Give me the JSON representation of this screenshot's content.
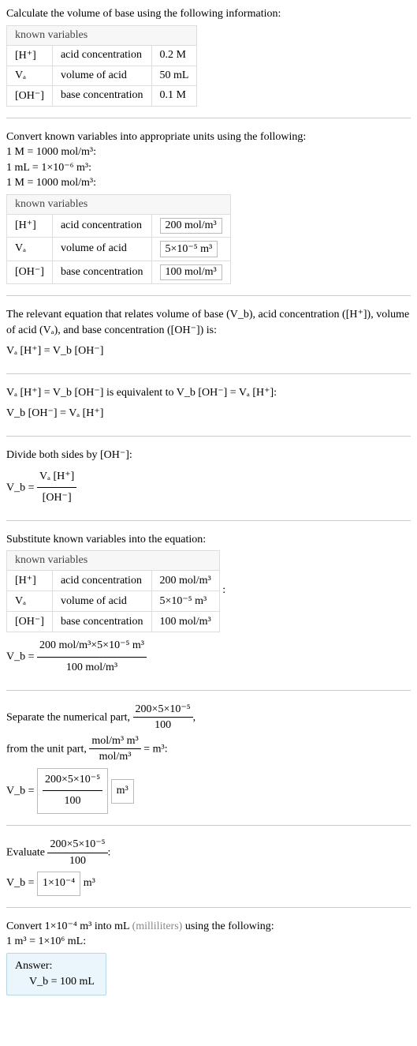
{
  "header1": "Calculate the volume of base using the following information:",
  "knownLabel": "known variables",
  "t1": {
    "r1": {
      "sym": "[H⁺]",
      "desc": "acid concentration",
      "val": "0.2 M"
    },
    "r2": {
      "sym": "Vₐ",
      "desc": "volume of acid",
      "val": "50 mL"
    },
    "r3": {
      "sym": "[OH⁻]",
      "desc": "base concentration",
      "val": "0.1 M"
    }
  },
  "convHeader": "Convert known variables into appropriate units using the following:",
  "conv1": "1 M = 1000 mol/m³:",
  "conv2": "1 mL = 1×10⁻⁶ m³:",
  "conv3": "1 M = 1000 mol/m³:",
  "t2": {
    "r1": {
      "sym": "[H⁺]",
      "desc": "acid concentration",
      "val": "200 mol/m³"
    },
    "r2": {
      "sym": "Vₐ",
      "desc": "volume of acid",
      "val": "5×10⁻⁵ m³"
    },
    "r3": {
      "sym": "[OH⁻]",
      "desc": "base concentration",
      "val": "100 mol/m³"
    }
  },
  "relText": "The relevant equation that relates volume of base (V_b), acid concentration ([H⁺]), volume of acid (Vₐ), and base concentration ([OH⁻]) is:",
  "relEq": "Vₐ [H⁺] = V_b [OH⁻]",
  "equivText": "Vₐ [H⁺] = V_b [OH⁻] is equivalent to V_b [OH⁻] = Vₐ [H⁺]:",
  "equivEq": "V_b [OH⁻] = Vₐ [H⁺]",
  "divText": "Divide both sides by [OH⁻]:",
  "divEq": {
    "lhs": "V_b = ",
    "num": "Vₐ [H⁺]",
    "den": "[OH⁻]"
  },
  "subHeader": "Substitute known variables into the equation:",
  "t3": {
    "r1": {
      "sym": "[H⁺]",
      "desc": "acid concentration",
      "val": "200 mol/m³"
    },
    "r2": {
      "sym": "Vₐ",
      "desc": "volume of acid",
      "val": "5×10⁻⁵ m³"
    },
    "r3": {
      "sym": "[OH⁻]",
      "desc": "base concentration",
      "val": "100 mol/m³"
    }
  },
  "subEq": {
    "lhs": "V_b = ",
    "num": "200 mol/m³×5×10⁻⁵ m³",
    "den": "100 mol/m³"
  },
  "sepText1": "Separate the numerical part, ",
  "sepFrac": {
    "num": "200×5×10⁻⁵",
    "den": "100"
  },
  "sepComma": ",",
  "sepText2": "from the unit part, ",
  "unitFrac": {
    "num": "mol/m³ m³",
    "den": "mol/m³"
  },
  "unitEq": " = m³:",
  "sepEq": {
    "lhs": "V_b = ",
    "num": "200×5×10⁻⁵",
    "den": "100",
    "unit": "m³"
  },
  "evalText": "Evaluate ",
  "evalFrac": {
    "num": "200×5×10⁻⁵",
    "den": "100"
  },
  "evalColon": ":",
  "evalEq": {
    "lhs": "V_b = ",
    "val": "1×10⁻⁴",
    "unit": " m³"
  },
  "convFinal1": "Convert 1×10⁻⁴ m³ into mL ",
  "convFinal1b": "(milliliters)",
  "convFinal1c": " using the following:",
  "convFinal2": "1 m³ = 1×10⁶ mL:",
  "answerLabel": "Answer:",
  "answerEq": "V_b = 100 mL",
  "colon": ":"
}
